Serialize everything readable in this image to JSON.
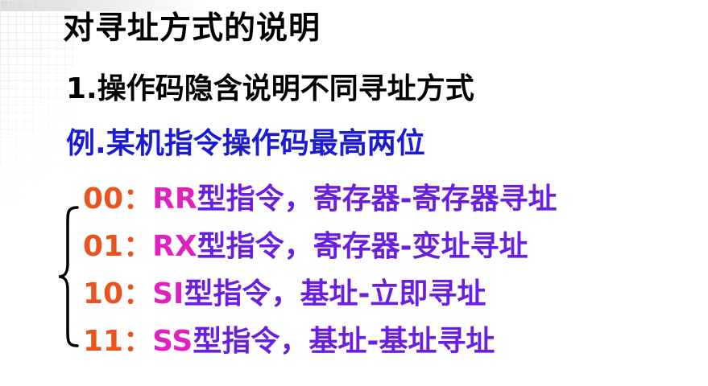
{
  "slide": {
    "title": "对寻址方式的说明",
    "point1": {
      "number": "1.",
      "text": "操作码隐含说明不同寻址方式"
    },
    "example": {
      "prefix": "例.",
      "text": "某机指令操作码最高两位"
    },
    "codes": [
      {
        "code": "00",
        "sep": "：",
        "type": "RR",
        "desc": "型指令，寄存器-寄存器寻址"
      },
      {
        "code": "01",
        "sep": "：",
        "type": "RX",
        "desc": "型指令，寄存器-变址寻址"
      },
      {
        "code": "10",
        "sep": "：",
        "type": "SI",
        "desc": "型指令，基址-立即寻址"
      },
      {
        "code": "11",
        "sep": "：",
        "type": "SS",
        "desc": "型指令，基址-基址寻址"
      }
    ]
  },
  "colors": {
    "title": "#000000",
    "example": "#1b1bd6",
    "code": "#e8531f",
    "type": "#e020c0",
    "desc": "#6a1ee0",
    "brace": "#000000"
  }
}
